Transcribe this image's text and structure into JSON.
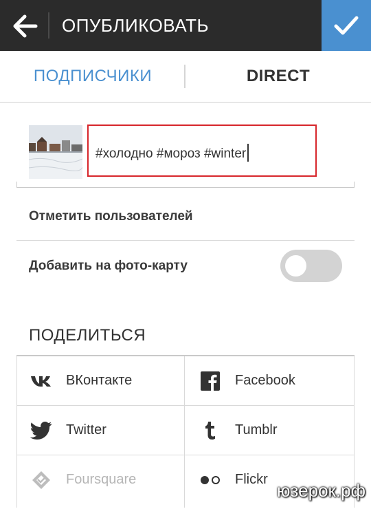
{
  "header": {
    "title": "ОПУБЛИКОВАТЬ",
    "back_icon": "arrow-left-icon",
    "confirm_icon": "check-icon",
    "bg_color": "#2b2b2b",
    "accent_color": "#4a90d0"
  },
  "tabs": [
    {
      "label": "ПОДПИСЧИКИ",
      "active": true
    },
    {
      "label": "DIRECT",
      "active": false
    }
  ],
  "caption": {
    "value": "#холодно #мороз #winter"
  },
  "options": {
    "tag_people": "Отметить пользователей",
    "add_to_map": "Добавить на фото-карту",
    "add_to_map_enabled": false
  },
  "share": {
    "title": "ПОДЕЛИТЬСЯ",
    "services": [
      {
        "label": "ВКонтакте",
        "icon": "vk-icon",
        "enabled": true
      },
      {
        "label": "Facebook",
        "icon": "facebook-icon",
        "enabled": true
      },
      {
        "label": "Twitter",
        "icon": "twitter-icon",
        "enabled": true
      },
      {
        "label": "Tumblr",
        "icon": "tumblr-icon",
        "enabled": true
      },
      {
        "label": "Foursquare",
        "icon": "foursquare-icon",
        "enabled": false
      },
      {
        "label": "Flickr",
        "icon": "flickr-icon",
        "enabled": true
      }
    ]
  },
  "watermark": "юзерок.рф"
}
